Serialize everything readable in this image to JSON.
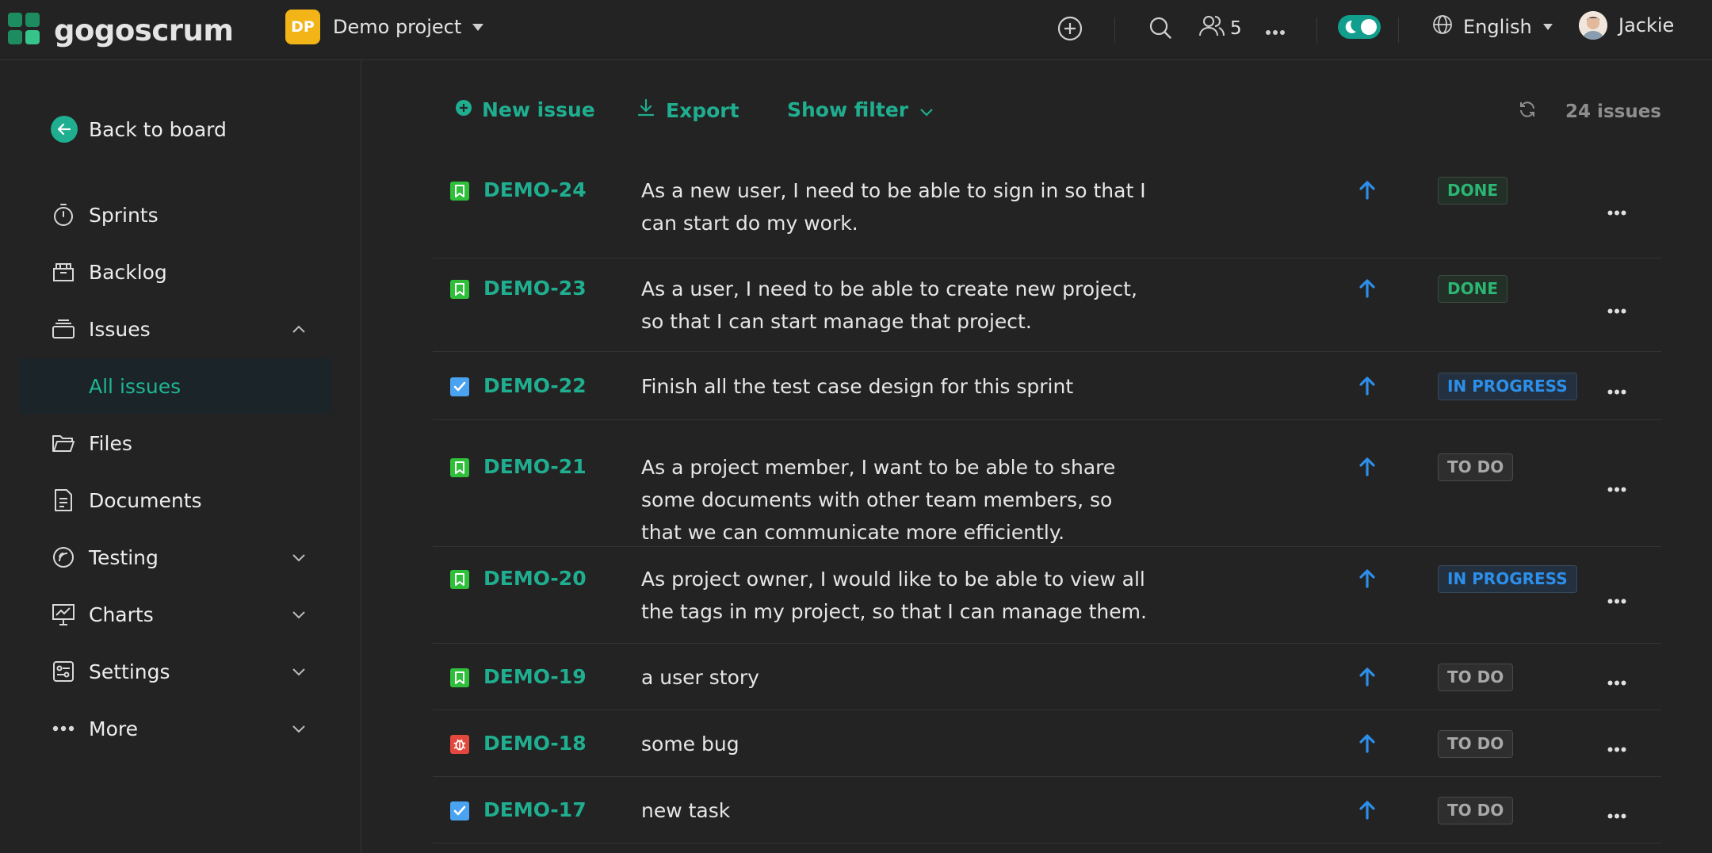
{
  "topbar": {
    "brand": "gogoscrum",
    "project": {
      "initials": "DP",
      "name": "Demo project"
    },
    "member_count": "5",
    "language": "English",
    "user_name": "Jackie"
  },
  "sidebar": {
    "back_label": "Back to board",
    "items": [
      {
        "label": "Sprints",
        "icon": "stopwatch-icon"
      },
      {
        "label": "Backlog",
        "icon": "backlog-box-icon"
      },
      {
        "label": "Issues",
        "icon": "issues-stack-icon",
        "expanded": true
      },
      {
        "label": "All issues",
        "active": true
      },
      {
        "label": "Files",
        "icon": "folder-icon"
      },
      {
        "label": "Documents",
        "icon": "document-icon"
      },
      {
        "label": "Testing",
        "icon": "testing-icon",
        "expanded": false
      },
      {
        "label": "Charts",
        "icon": "chart-board-icon",
        "expanded": false
      },
      {
        "label": "Settings",
        "icon": "settings-panel-icon",
        "expanded": false
      },
      {
        "label": "More",
        "icon": "more-dots-icon",
        "expanded": false
      }
    ]
  },
  "toolbar": {
    "new_issue": "New issue",
    "export": "Export",
    "show_filter": "Show filter",
    "issue_count": "24 issues"
  },
  "colors": {
    "accent": "#1fae8f",
    "story": "#2fbf3a",
    "task": "#4aa3f0",
    "bug": "#e2483c",
    "priority": "#2d8fea"
  },
  "issues": [
    {
      "key": "DEMO-24",
      "type": "story",
      "summary": "As a new user, I need to be able to sign in so that I can start do my work.",
      "priority": "high",
      "status": "DONE"
    },
    {
      "key": "DEMO-23",
      "type": "story",
      "summary": "As a user, I need to be able to create new project, so that I can start manage that project.",
      "priority": "high",
      "status": "DONE"
    },
    {
      "key": "DEMO-22",
      "type": "task",
      "summary": "Finish all the test case design for this sprint",
      "priority": "high",
      "status": "IN PROGRESS"
    },
    {
      "key": "DEMO-21",
      "type": "story",
      "summary": "As a project member, I want to be able to share some documents with other team members, so that we can communicate more efficiently.",
      "priority": "high",
      "status": "TO DO"
    },
    {
      "key": "DEMO-20",
      "type": "story",
      "summary": "As project owner, I would like to be able to view all the tags in my project, so that I can manage them.",
      "priority": "high",
      "status": "IN PROGRESS"
    },
    {
      "key": "DEMO-19",
      "type": "story",
      "summary": "a user story",
      "priority": "high",
      "status": "TO DO"
    },
    {
      "key": "DEMO-18",
      "type": "bug",
      "summary": "some bug",
      "priority": "high",
      "status": "TO DO"
    },
    {
      "key": "DEMO-17",
      "type": "task",
      "summary": "new task",
      "priority": "high",
      "status": "TO DO"
    }
  ]
}
